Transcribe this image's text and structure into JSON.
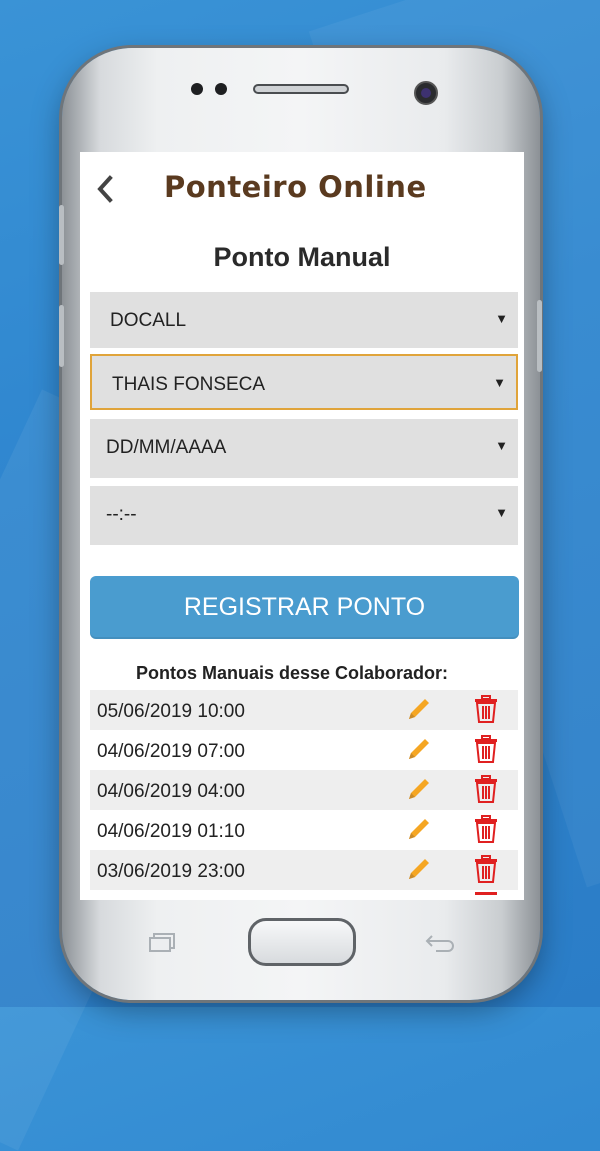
{
  "app": {
    "title": "Ponteiro Online"
  },
  "page": {
    "title": "Ponto Manual"
  },
  "form": {
    "company": "DOCALL",
    "employee": "THAIS FONSECA",
    "date": "DD/MM/AAAA",
    "time": "--:--",
    "caret": "▼",
    "submit_label": "REGISTRAR PONTO"
  },
  "list": {
    "title": "Pontos Manuais desse Colaborador:",
    "rows": [
      {
        "datetime": "05/06/2019 10:00"
      },
      {
        "datetime": "04/06/2019 07:00"
      },
      {
        "datetime": "04/06/2019 04:00"
      },
      {
        "datetime": "04/06/2019 01:10"
      },
      {
        "datetime": "03/06/2019 23:00"
      }
    ]
  },
  "icons": {
    "back": "chevron-left-icon",
    "edit": "pencil-icon",
    "delete": "trash-icon"
  },
  "colors": {
    "brand_title": "#5a3a1f",
    "button": "#4a9ccf",
    "delete": "#e02020",
    "edit": "#f5a623",
    "focus_border": "#e0a43a"
  }
}
